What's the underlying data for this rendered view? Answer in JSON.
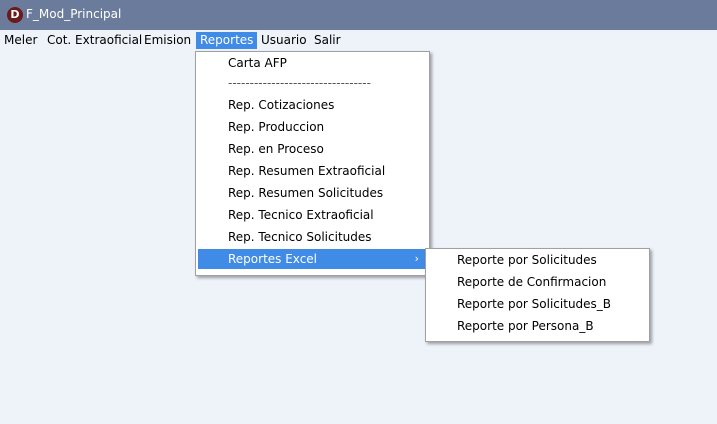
{
  "window": {
    "logo_letter": "D",
    "title": "F_Mod_Principal"
  },
  "menubar": {
    "items": [
      "Meler",
      "Cot. Extraoficial",
      "Emision",
      "Reportes",
      "Usuario",
      "Salir"
    ],
    "active": "Reportes"
  },
  "reportes_menu": {
    "items": [
      "Carta AFP",
      "---------------------------------",
      "Rep. Cotizaciones",
      "Rep. Produccion",
      "Rep. en Proceso",
      "Rep. Resumen Extraoficial",
      "Rep. Resumen Solicitudes",
      "Rep. Tecnico Extraoficial",
      "Rep. Tecnico Solicitudes",
      "Reportes Excel"
    ],
    "submenu_arrow": "›",
    "highlighted": "Reportes Excel"
  },
  "reportes_excel_submenu": {
    "items": [
      "Reporte por Solicitudes",
      "Reporte de Confirmacion",
      "Reporte por Solicitudes_B",
      "Reporte por Persona_B"
    ]
  },
  "colors": {
    "titlebar": "#6b7b9b",
    "highlight": "#3f8be6",
    "background": "#eef3fa"
  }
}
